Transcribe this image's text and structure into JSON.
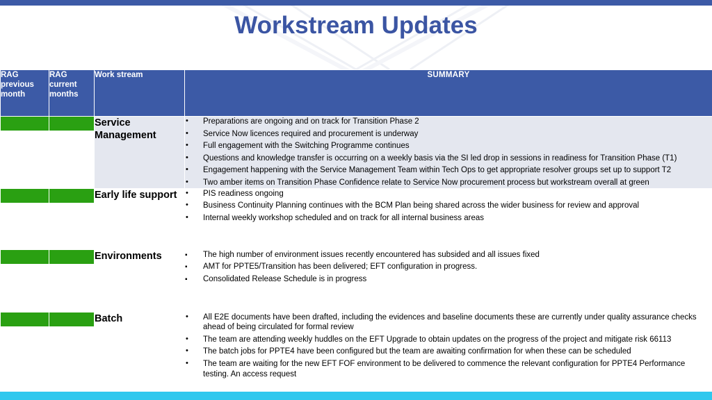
{
  "theme": {
    "top_bar_color": "#3c5aa6",
    "bottom_bar_color": "#2fc8ee",
    "title_color": "#3b55a3",
    "header_color": "#3c5aa6",
    "rag_green": "#2aa012",
    "shaded_row_color": "#e4e7ef"
  },
  "title": "Workstream Updates",
  "table": {
    "headers": {
      "rag_previous": "RAG previous month",
      "rag_current": "RAG current months",
      "work_stream": "Work stream",
      "summary": "SUMMARY"
    },
    "rows": [
      {
        "work_stream": "Service Management",
        "rag_previous": "green",
        "rag_current": "green",
        "bullet_style": "dot",
        "summary": [
          "Preparations are ongoing and on track for Transition Phase 2",
          "Service Now licences required and procurement is underway",
          "Full engagement with the Switching Programme continues",
          "Questions and knowledge transfer is occurring on a weekly basis via the SI led drop in sessions in readiness for Transition Phase (T1)",
          "Engagement happening with the Service Management Team within Tech Ops to get appropriate resolver groups set up to support T2",
          "Two amber items on Transition Phase Confidence relate to Service Now procurement process but workstream overall at green"
        ]
      },
      {
        "work_stream": "Early life support",
        "rag_previous": "green",
        "rag_current": "green",
        "bullet_style": "dot",
        "summary": [
          "PIS readiness ongoing",
          "Business Continuity Planning continues with the BCM Plan being shared across the wider business for review and approval",
          "Internal weekly workshop scheduled and on track for all internal business areas"
        ]
      },
      {
        "work_stream": "Environments",
        "rag_previous": "green",
        "rag_current": "green",
        "bullet_style": "square",
        "summary": [
          "The high number of environment issues recently encountered has subsided and all issues fixed",
          "AMT for PPTE5/Transition has been delivered; EFT configuration in progress.",
          "Consolidated Release Schedule is in progress"
        ]
      },
      {
        "work_stream": "Batch",
        "rag_previous": "green",
        "rag_current": "green",
        "bullet_style": "dot",
        "summary": [
          "All E2E documents have been drafted, including the evidences and baseline documents these are currently under quality assurance checks ahead of being circulated for formal review",
          "The team are attending weekly huddles on the EFT Upgrade to obtain updates on the progress of the project and mitigate risk 66113",
          "The batch jobs for PPTE4 have been configured but the team are awaiting confirmation for when these can be scheduled",
          "The team are waiting for the new EFT FOF environment to be delivered to commence the relevant configuration for PPTE4 Performance testing. An access request"
        ]
      }
    ]
  }
}
